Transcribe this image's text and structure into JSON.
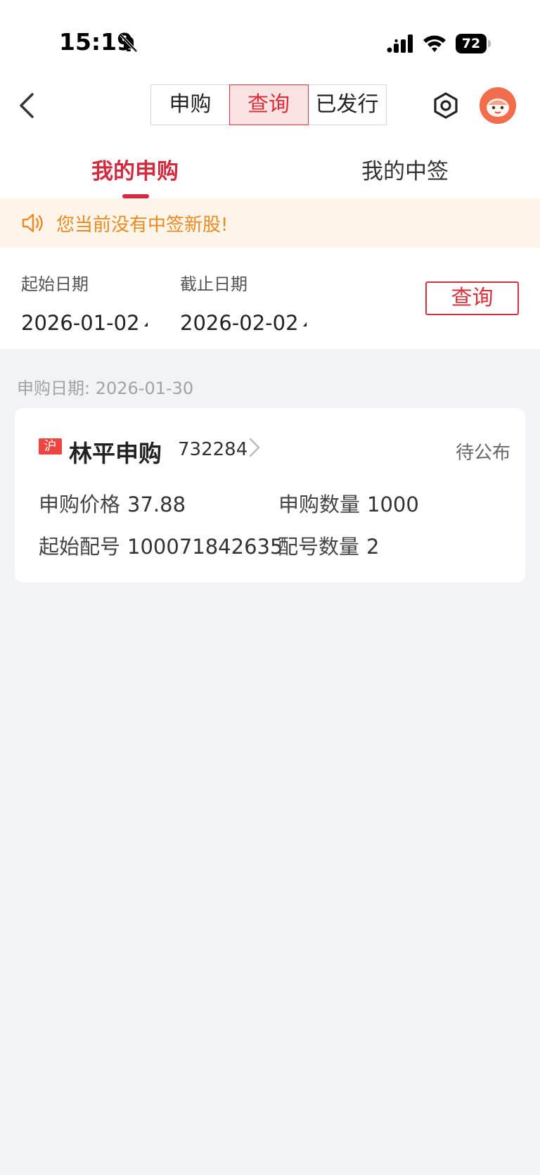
{
  "status_bar": {
    "time": "15:19",
    "battery": "72"
  },
  "nav": {
    "segments": [
      "申购",
      "查询",
      "已发行"
    ],
    "active_segment": "查询"
  },
  "tabs": {
    "my_subscriptions": "我的申购",
    "my_winnings": "我的中签"
  },
  "notice": "您当前没有中签新股!",
  "filter": {
    "start_label": "起始日期",
    "end_label": "截止日期",
    "start_date": "2026-01-02",
    "end_date": "2026-02-02",
    "query_button": "查询"
  },
  "section": {
    "date_label": "申购日期: 2026-01-30"
  },
  "record": {
    "market_badge": "沪",
    "name": "林平申购",
    "code": "732284",
    "status": "待公布",
    "price_label": "申购价格",
    "price": "37.88",
    "qty_label": "申购数量",
    "qty": "1000",
    "start_no_label": "起始配号",
    "start_no": "100071842635",
    "count_label": "配号数量",
    "count": "2"
  },
  "colors": {
    "accent": "#d22a3f",
    "notice_text": "#ec8a22",
    "page_bg": "#f2f3f7"
  }
}
